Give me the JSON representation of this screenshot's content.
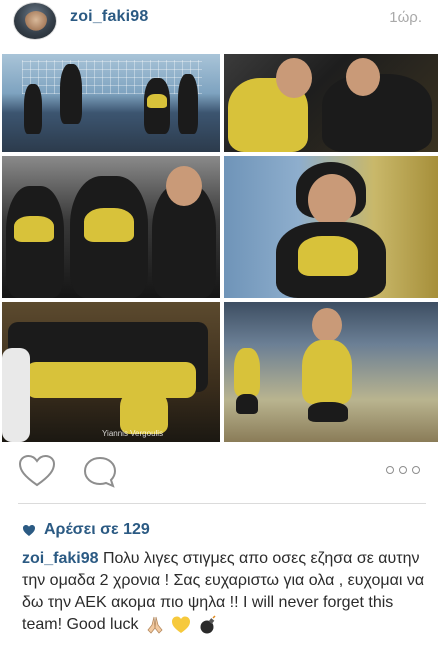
{
  "post": {
    "username": "zoi_faki98",
    "time": "1ώρ.",
    "likes_text": "Αρέσει σε 129",
    "caption_user": "zoi_faki98",
    "caption_text": "Πολυ λιγες στιγμες απο οσες εζησα σε αυτην την ομαδα 2 χρονια ! Σας ευχαριστω για ολα , ευχομαι να δω την ΑΕΚ ακομα πιο ψηλα !! I will never forget this team! Good luck",
    "caption_emojis": [
      "praying-hands",
      "yellow-heart",
      "bomb"
    ],
    "photo_watermark": "Yiannis Vergoulis"
  },
  "icons": {
    "like": "heart-outline-icon",
    "comment": "speech-bubble-icon",
    "more": "ellipsis-icon",
    "liked": "small-heart-icon"
  },
  "colors": {
    "username": "#2b5a83",
    "timestamp": "#a9a9a9",
    "text": "#262626",
    "team_yellow": "#d8c23a"
  }
}
